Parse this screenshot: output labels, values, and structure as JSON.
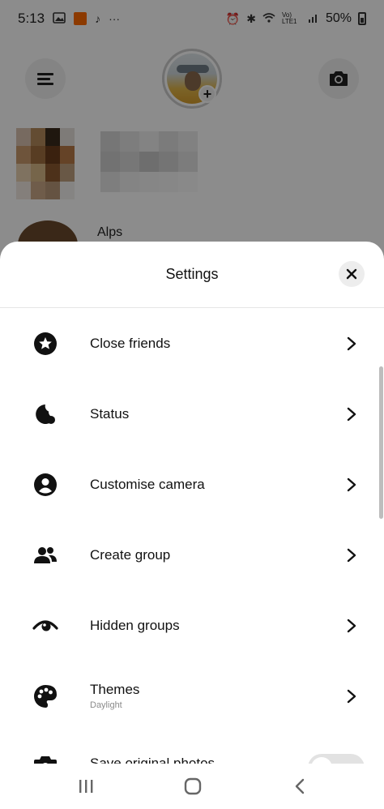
{
  "status_bar": {
    "time": "5:13",
    "network_label": "Vo) LTE1",
    "battery": "50%"
  },
  "background": {
    "contact_name": "Alps"
  },
  "sheet": {
    "title": "Settings",
    "items": [
      {
        "label": "Close friends",
        "icon": "star-circle-icon"
      },
      {
        "label": "Status",
        "icon": "status-dot-icon"
      },
      {
        "label": "Customise camera",
        "icon": "person-circle-icon"
      },
      {
        "label": "Create group",
        "icon": "group-icon"
      },
      {
        "label": "Hidden groups",
        "icon": "hidden-eye-icon"
      },
      {
        "label": "Themes",
        "sublabel": "Daylight",
        "icon": "palette-icon"
      },
      {
        "label": "Save original photos",
        "icon": "camera-icon",
        "toggle_on": false
      }
    ]
  },
  "colors": {
    "accent_orange": "#ff6a00",
    "sheet_bg": "#ffffff",
    "secondary_text": "#8a8a8a"
  }
}
